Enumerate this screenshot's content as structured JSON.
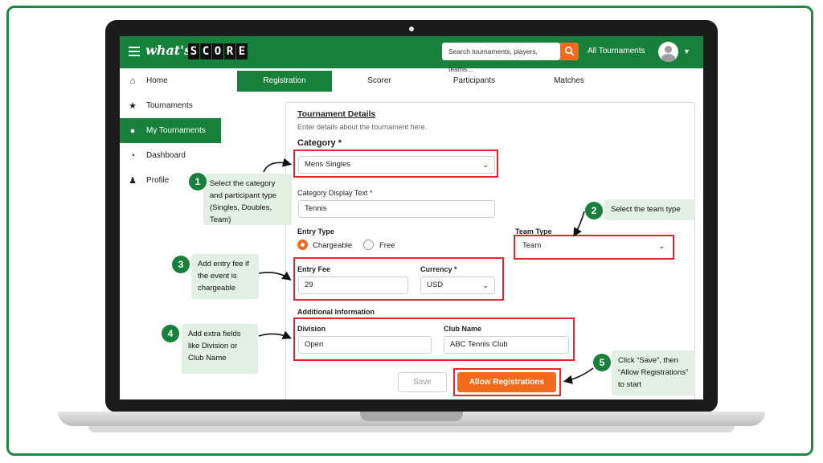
{
  "app": {
    "logo_prefix": "what's",
    "logo_letters": [
      "S",
      "C",
      "O",
      "R",
      "E"
    ],
    "search_placeholder": "Search tournaments, players, teams...",
    "all_tournaments": "All Tournaments"
  },
  "sidebar": {
    "items": [
      {
        "label": "Home",
        "icon": "home-icon",
        "active": false
      },
      {
        "label": "Tournaments",
        "icon": "trophy-icon",
        "active": false
      },
      {
        "label": "My Tournaments",
        "icon": "cap-icon",
        "active": true
      },
      {
        "label": "Dashboard",
        "icon": "dashboard-icon",
        "active": false
      },
      {
        "label": "Profile",
        "icon": "user-icon",
        "active": false
      }
    ]
  },
  "tabs": [
    "Registration",
    "Scorer",
    "Participants",
    "Matches"
  ],
  "form": {
    "title": "Tournament Details",
    "subtitle": "Enter details about the tournament here.",
    "category_label": "Category *",
    "category_value": "Mens Singles",
    "display_text_label": "Category Display Text *",
    "display_text_value": "Tennis",
    "entry_type_label": "Entry Type",
    "entry_type_options": [
      "Chargeable",
      "Free"
    ],
    "entry_type_selected": "Chargeable",
    "team_type_label": "Team Type",
    "team_type_value": "Team",
    "entry_fee_label": "Entry Fee",
    "entry_fee_value": "29",
    "currency_label": "Currency *",
    "currency_value": "USD",
    "additional_label": "Additional Information",
    "division_label": "Division",
    "division_value": "Open",
    "club_label": "Club Name",
    "club_value": "ABC Tennis Club",
    "save_label": "Save",
    "allow_label": "Allow Registrations"
  },
  "callouts": [
    {
      "num": "1",
      "text": "Select the category and participant type (Singles, Doubles, Team)"
    },
    {
      "num": "2",
      "text": "Select the team type"
    },
    {
      "num": "3",
      "text": "Add entry fee if the event is chargeable"
    },
    {
      "num": "4",
      "text": "Add extra fields like Division or Club Name"
    },
    {
      "num": "5",
      "text": "Click “Save”, then “Allow Registrations” to start"
    }
  ],
  "colors": {
    "brand_green": "#17813b",
    "accent_orange": "#f26a1b",
    "highlight_red": "#e8262b",
    "callout_bg": "#e2efe3"
  }
}
